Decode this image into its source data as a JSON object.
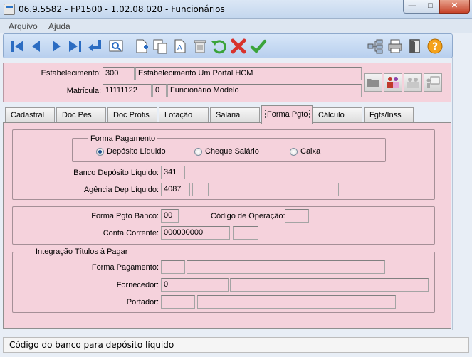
{
  "window": {
    "title": "06.9.5582 - FP1500 - 1.02.08.020 - Funcionários",
    "min_glyph": "—",
    "max_glyph": "□",
    "close_glyph": "✕"
  },
  "menu": {
    "file": "Arquivo",
    "help": "Ajuda"
  },
  "header": {
    "establishment_label": "Estabelecimento:",
    "establishment_code": "300",
    "establishment_name": "Estabelecimento Um Portal HCM",
    "registration_label": "Matrícula:",
    "registration_number": "11111122",
    "registration_digit": "0",
    "employee_name": "Funcionário Modelo"
  },
  "tabs": [
    "Cadastral",
    "Doc Pes",
    "Doc Profis",
    "Lotação",
    "Salarial",
    "Forma Pgto",
    "Cálculo",
    "Fgts/Inss"
  ],
  "payment_method": {
    "legend": "Forma Pagamento",
    "options": [
      "Depósito Líquido",
      "Cheque Salário",
      "Caixa"
    ],
    "selected": "Depósito Líquido",
    "bank_label": "Banco Depósito Líquido:",
    "bank_code": "341",
    "bank_name": "",
    "agency_label": "Agência Dep Líquido:",
    "agency_code": "4087",
    "agency_digit": "",
    "agency_name": ""
  },
  "bank_account": {
    "payment_bank_label": "Forma Pgto Banco:",
    "payment_bank_value": "00",
    "operation_label": "Código de Operação:",
    "operation_value": "",
    "account_label": "Conta Corrente:",
    "account_value": "000000000",
    "account_digit": ""
  },
  "payables": {
    "legend": "Integração Títulos à Pagar",
    "method_label": "Forma Pagamento:",
    "method_code": "",
    "method_desc": "",
    "supplier_label": "Fornecedor:",
    "supplier_code": "0",
    "supplier_name": "",
    "bearer_label": "Portador:",
    "bearer_code": "",
    "bearer_name": ""
  },
  "status": {
    "message": "Código do banco para depósito líquido"
  },
  "colors": {
    "panel": "#f5d2dc",
    "toolbar": "#c7daf2",
    "accent_blue": "#2b74c7",
    "confirm_green": "#3aa33a",
    "cancel_red": "#d8322c"
  }
}
